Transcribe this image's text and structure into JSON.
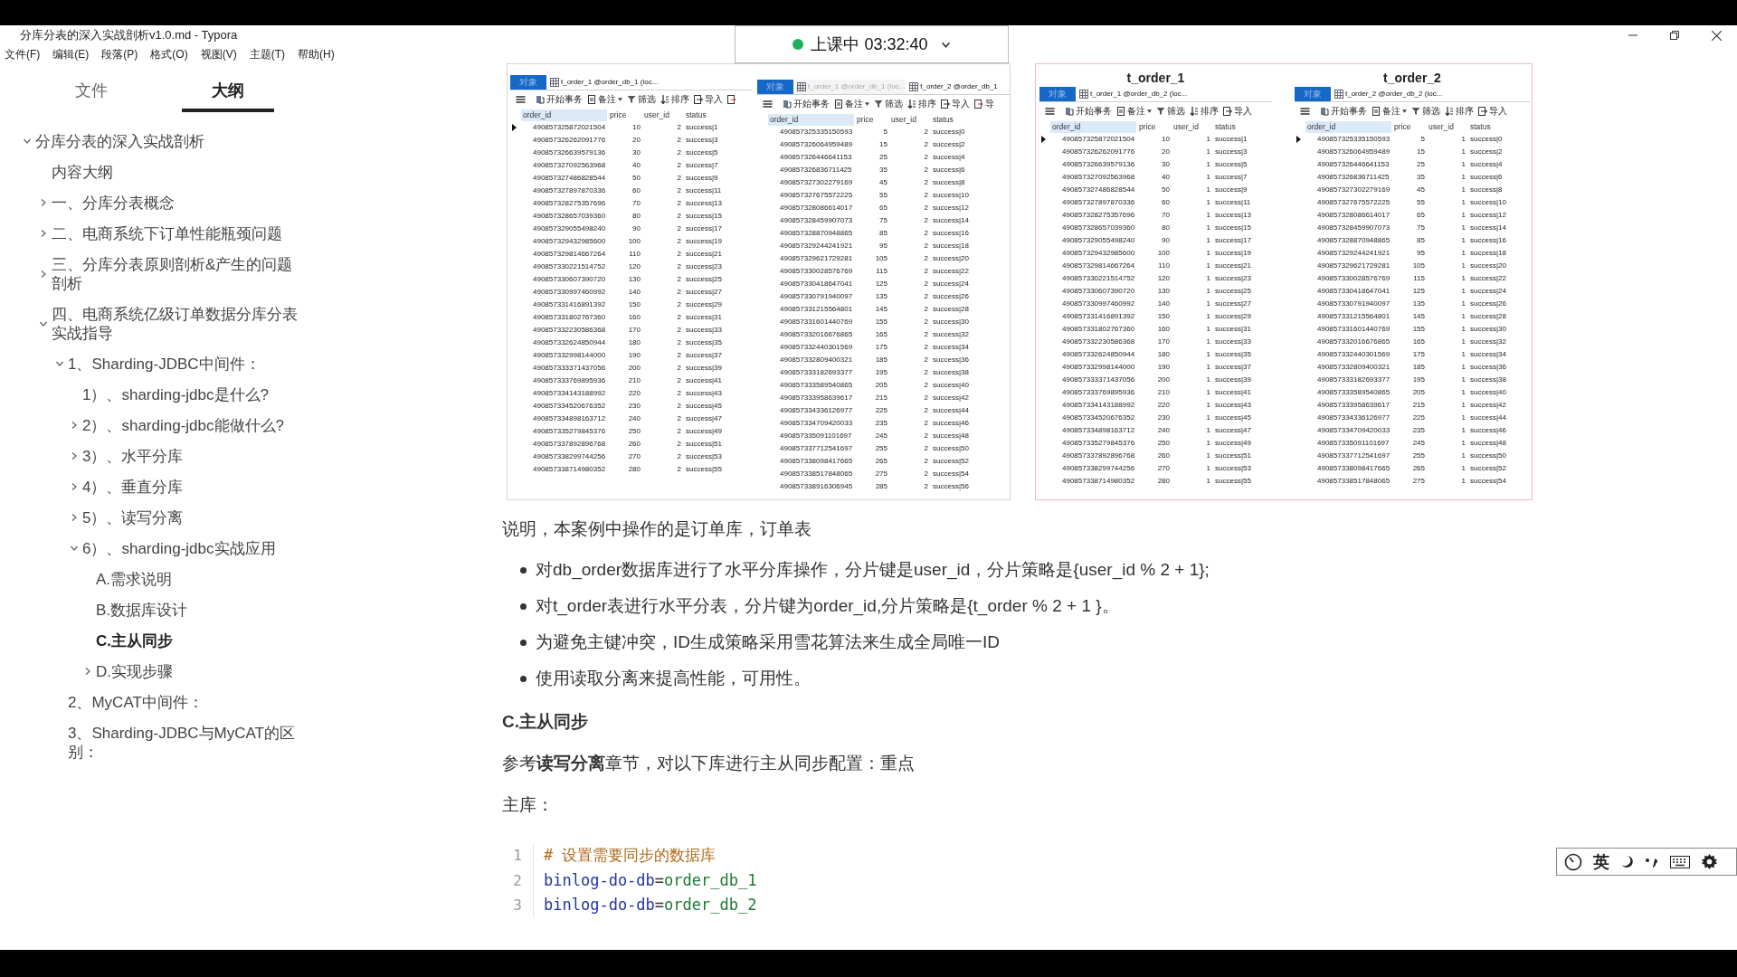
{
  "window": {
    "title": "分库分表的深入实战剖析v1.0.md - Typora"
  },
  "class_status": {
    "label": "上课中 03:32:40"
  },
  "menu": [
    "文件(F)",
    "编辑(E)",
    "段落(P)",
    "格式(O)",
    "视图(V)",
    "主题(T)",
    "帮助(H)"
  ],
  "sidebar": {
    "tabs": [
      {
        "label": "文件",
        "selected": false
      },
      {
        "label": "大纲",
        "selected": true
      }
    ],
    "outline": [
      {
        "label": "分库分表的深入实战剖析",
        "kind": "branch",
        "expanded": true,
        "selected": false,
        "children": [
          {
            "label": "内容大纲",
            "kind": "leaf",
            "selected": false
          },
          {
            "label": "一、分库分表概念",
            "kind": "branch",
            "expanded": false,
            "selected": false
          },
          {
            "label": "二、电商系统下订单性能瓶颈问题",
            "kind": "branch",
            "expanded": false,
            "selected": false
          },
          {
            "label": "三、分库分表原则剖析&产生的问题剖析",
            "kind": "branch",
            "expanded": false,
            "selected": false
          },
          {
            "label": "四、电商系统亿级订单数据分库分表实战指导",
            "kind": "branch",
            "expanded": true,
            "selected": false,
            "children": [
              {
                "label": "1、Sharding-JDBC中间件：",
                "kind": "branch",
                "expanded": true,
                "selected": false,
                "children": [
                  {
                    "label": "1）、sharding-jdbc是什么?",
                    "kind": "leaf",
                    "selected": false
                  },
                  {
                    "label": "2）、sharding-jdbc能做什么?",
                    "kind": "branch",
                    "expanded": false,
                    "selected": false
                  },
                  {
                    "label": "3）、水平分库",
                    "kind": "branch",
                    "expanded": false,
                    "selected": false
                  },
                  {
                    "label": "4）、垂直分库",
                    "kind": "branch",
                    "expanded": false,
                    "selected": false
                  },
                  {
                    "label": "5）、读写分离",
                    "kind": "branch",
                    "expanded": false,
                    "selected": false
                  },
                  {
                    "label": "6）、sharding-jdbc实战应用",
                    "kind": "branch",
                    "expanded": true,
                    "selected": false,
                    "children": [
                      {
                        "label": "A.需求说明",
                        "kind": "leaf",
                        "selected": false
                      },
                      {
                        "label": "B.数据库设计",
                        "kind": "leaf",
                        "selected": false
                      },
                      {
                        "label": "C.主从同步",
                        "kind": "leaf",
                        "selected": true
                      },
                      {
                        "label": "D.实现步骤",
                        "kind": "branch",
                        "expanded": false,
                        "selected": false
                      }
                    ]
                  }
                ]
              },
              {
                "label": "2、MyCAT中间件：",
                "kind": "leaf",
                "selected": false
              },
              {
                "label": "3、Sharding-JDBC与MyCAT的区别：",
                "kind": "leaf",
                "selected": false
              }
            ]
          }
        ]
      }
    ]
  },
  "document": {
    "images": [
      {
        "tables": [
          {
            "cursor_on_first_row": true,
            "tabs": [
              {
                "kind": "objects",
                "label": "对象"
              },
              {
                "kind": "table",
                "label": "t_order_1 @order_db_1 (loc...",
                "selected": true
              }
            ],
            "toolbar": [
              {
                "kind": "begin",
                "label": "开始事务"
              },
              {
                "kind": "note",
                "label": "备注"
              },
              {
                "kind": "filter",
                "label": "筛选"
              },
              {
                "kind": "sort",
                "label": "排序"
              },
              {
                "kind": "import",
                "label": "导入"
              },
              {
                "kind": "export"
              }
            ],
            "columns": [
              "order_id",
              "price",
              "user_id",
              "status"
            ],
            "rows": [
              [
                "490857325872021504",
                "10",
                "2",
                "success|1"
              ],
              [
                "490857326262091776",
                "20",
                "2",
                "success|3"
              ],
              [
                "490857326639579136",
                "30",
                "2",
                "success|5"
              ],
              [
                "490857327092563968",
                "40",
                "2",
                "success|7"
              ],
              [
                "490857327486828544",
                "50",
                "2",
                "success|9"
              ],
              [
                "490857327897870336",
                "60",
                "2",
                "success|11"
              ],
              [
                "490857328275357696",
                "70",
                "2",
                "success|13"
              ],
              [
                "490857328657039360",
                "80",
                "2",
                "success|15"
              ],
              [
                "490857329055498240",
                "90",
                "2",
                "success|17"
              ],
              [
                "490857329432985600",
                "100",
                "2",
                "success|19"
              ],
              [
                "490857329814667264",
                "110",
                "2",
                "success|21"
              ],
              [
                "490857330221514752",
                "120",
                "2",
                "success|23"
              ],
              [
                "490857330607390720",
                "130",
                "2",
                "success|25"
              ],
              [
                "490857330997460992",
                "140",
                "2",
                "success|27"
              ],
              [
                "490857331416891392",
                "150",
                "2",
                "success|29"
              ],
              [
                "490857331802767360",
                "160",
                "2",
                "success|31"
              ],
              [
                "490857332230586368",
                "170",
                "2",
                "success|33"
              ],
              [
                "490857332624850944",
                "180",
                "2",
                "success|35"
              ],
              [
                "490857332998144000",
                "190",
                "2",
                "success|37"
              ],
              [
                "490857333371437056",
                "200",
                "2",
                "success|39"
              ],
              [
                "490857333769895936",
                "210",
                "2",
                "success|41"
              ],
              [
                "490857334143188992",
                "220",
                "2",
                "success|43"
              ],
              [
                "490857334520676352",
                "230",
                "2",
                "success|45"
              ],
              [
                "490857334898163712",
                "240",
                "2",
                "success|47"
              ],
              [
                "490857335279845376",
                "250",
                "2",
                "success|49"
              ],
              [
                "490857337892896768",
                "260",
                "2",
                "success|51"
              ],
              [
                "490857338299744256",
                "270",
                "2",
                "success|53"
              ],
              [
                "490857338714980352",
                "280",
                "2",
                "success|55"
              ]
            ]
          },
          {
            "cursor_on_first_row": false,
            "tabs": [
              {
                "kind": "objects",
                "label": "对象"
              },
              {
                "kind": "table",
                "label": "t_order_1 @order_db_1 (loc...",
                "selected": false
              },
              {
                "kind": "table",
                "label": "t_order_2 @order_db_1",
                "selected": true
              }
            ],
            "toolbar": [
              {
                "kind": "begin",
                "label": "开始事务"
              },
              {
                "kind": "note",
                "label": "备注"
              },
              {
                "kind": "filter",
                "label": "筛选"
              },
              {
                "kind": "sort",
                "label": "排序"
              },
              {
                "kind": "import",
                "label": "导入"
              },
              {
                "kind": "export",
                "label": "导"
              }
            ],
            "columns": [
              "order_id",
              "price",
              "user_id",
              "status"
            ],
            "rows": [
              [
                "490857325335150593",
                "5",
                "2",
                "success|0"
              ],
              [
                "490857326064959489",
                "15",
                "2",
                "success|2"
              ],
              [
                "490857326446641153",
                "25",
                "2",
                "success|4"
              ],
              [
                "490857326836711425",
                "35",
                "2",
                "success|6"
              ],
              [
                "490857327302279169",
                "45",
                "2",
                "success|8"
              ],
              [
                "490857327675572225",
                "55",
                "2",
                "success|10"
              ],
              [
                "490857328086614017",
                "65",
                "2",
                "success|12"
              ],
              [
                "490857328459907073",
                "75",
                "2",
                "success|14"
              ],
              [
                "490857328870948865",
                "85",
                "2",
                "success|16"
              ],
              [
                "490857329244241921",
                "95",
                "2",
                "success|18"
              ],
              [
                "490857329621729281",
                "105",
                "2",
                "success|20"
              ],
              [
                "490857330028576769",
                "115",
                "2",
                "success|22"
              ],
              [
                "490857330418647041",
                "125",
                "2",
                "success|24"
              ],
              [
                "490857330791940097",
                "135",
                "2",
                "success|26"
              ],
              [
                "490857331215564801",
                "145",
                "2",
                "success|28"
              ],
              [
                "490857331601440769",
                "155",
                "2",
                "success|30"
              ],
              [
                "490857332016676865",
                "165",
                "2",
                "success|32"
              ],
              [
                "490857332440301569",
                "175",
                "2",
                "success|34"
              ],
              [
                "490857332809400321",
                "185",
                "2",
                "success|36"
              ],
              [
                "490857333182693377",
                "195",
                "2",
                "success|38"
              ],
              [
                "490857333589540865",
                "205",
                "2",
                "success|40"
              ],
              [
                "490857333958639617",
                "215",
                "2",
                "success|42"
              ],
              [
                "490857334336126977",
                "225",
                "2",
                "success|44"
              ],
              [
                "490857334709420033",
                "235",
                "2",
                "success|46"
              ],
              [
                "490857335091101697",
                "245",
                "2",
                "success|48"
              ],
              [
                "490857337712541697",
                "255",
                "2",
                "success|50"
              ],
              [
                "490857338098417665",
                "265",
                "2",
                "success|52"
              ],
              [
                "490857338517848065",
                "275",
                "2",
                "success|54"
              ],
              [
                "490857338916306945",
                "285",
                "2",
                "success|56"
              ]
            ]
          }
        ]
      },
      {
        "tables": [
          {
            "title": "t_order_1",
            "cursor_on_first_row": true,
            "tabs": [
              {
                "kind": "objects",
                "label": "对象"
              },
              {
                "kind": "table",
                "label": "t_order_1 @order_db_2 (loc...",
                "selected": true
              }
            ],
            "toolbar": [
              {
                "kind": "begin",
                "label": "开始事务"
              },
              {
                "kind": "note",
                "label": "备注"
              },
              {
                "kind": "filter",
                "label": "筛选"
              },
              {
                "kind": "sort",
                "label": "排序"
              },
              {
                "kind": "import",
                "label": "导入"
              }
            ],
            "columns": [
              "order_id",
              "price",
              "user_id",
              "status"
            ],
            "rows": [
              [
                "490857325872021504",
                "10",
                "1",
                "success|1"
              ],
              [
                "490857326262091776",
                "20",
                "1",
                "success|3"
              ],
              [
                "490857326639579136",
                "30",
                "1",
                "success|5"
              ],
              [
                "490857327092563968",
                "40",
                "1",
                "success|7"
              ],
              [
                "490857327486828544",
                "50",
                "1",
                "success|9"
              ],
              [
                "490857327897870336",
                "60",
                "1",
                "success|11"
              ],
              [
                "490857328275357696",
                "70",
                "1",
                "success|13"
              ],
              [
                "490857328657039360",
                "80",
                "1",
                "success|15"
              ],
              [
                "490857329055498240",
                "90",
                "1",
                "success|17"
              ],
              [
                "490857329432985600",
                "100",
                "1",
                "success|19"
              ],
              [
                "490857329814667264",
                "110",
                "1",
                "success|21"
              ],
              [
                "490857330221514752",
                "120",
                "1",
                "success|23"
              ],
              [
                "490857330607390720",
                "130",
                "1",
                "success|25"
              ],
              [
                "490857330997460992",
                "140",
                "1",
                "success|27"
              ],
              [
                "490857331416891392",
                "150",
                "1",
                "success|29"
              ],
              [
                "490857331802767360",
                "160",
                "1",
                "success|31"
              ],
              [
                "490857332230586368",
                "170",
                "1",
                "success|33"
              ],
              [
                "490857332624850944",
                "180",
                "1",
                "success|35"
              ],
              [
                "490857332998144000",
                "190",
                "1",
                "success|37"
              ],
              [
                "490857333371437056",
                "200",
                "1",
                "success|39"
              ],
              [
                "490857333769895936",
                "210",
                "1",
                "success|41"
              ],
              [
                "490857334143188992",
                "220",
                "1",
                "success|43"
              ],
              [
                "490857334520676352",
                "230",
                "1",
                "success|45"
              ],
              [
                "490857334898163712",
                "240",
                "1",
                "success|47"
              ],
              [
                "490857335279845376",
                "250",
                "1",
                "success|49"
              ],
              [
                "490857337892896768",
                "260",
                "1",
                "success|51"
              ],
              [
                "490857338299744256",
                "270",
                "1",
                "success|53"
              ],
              [
                "490857338714980352",
                "280",
                "1",
                "success|55"
              ]
            ]
          },
          {
            "title": "t_order_2",
            "cursor_on_first_row": true,
            "tabs": [
              {
                "kind": "objects",
                "label": "对象"
              },
              {
                "kind": "table",
                "label": "t_order_2 @order_db_2 (loc...",
                "selected": true
              }
            ],
            "toolbar": [
              {
                "kind": "begin",
                "label": "开始事务"
              },
              {
                "kind": "note",
                "label": "备注"
              },
              {
                "kind": "filter",
                "label": "筛选"
              },
              {
                "kind": "sort",
                "label": "排序"
              },
              {
                "kind": "import",
                "label": "导入"
              }
            ],
            "columns": [
              "order_id",
              "price",
              "user_id",
              "status"
            ],
            "rows": [
              [
                "490857325335150593",
                "5",
                "1",
                "success|0"
              ],
              [
                "490857326064959489",
                "15",
                "1",
                "success|2"
              ],
              [
                "490857326446641153",
                "25",
                "1",
                "success|4"
              ],
              [
                "490857326836711425",
                "35",
                "1",
                "success|6"
              ],
              [
                "490857327302279169",
                "45",
                "1",
                "success|8"
              ],
              [
                "490857327675572225",
                "55",
                "1",
                "success|10"
              ],
              [
                "490857328086614017",
                "65",
                "1",
                "success|12"
              ],
              [
                "490857328459907073",
                "75",
                "1",
                "success|14"
              ],
              [
                "490857328870948865",
                "85",
                "1",
                "success|16"
              ],
              [
                "490857329244241921",
                "95",
                "1",
                "success|18"
              ],
              [
                "490857329621729281",
                "105",
                "1",
                "success|20"
              ],
              [
                "490857330028576769",
                "115",
                "1",
                "success|22"
              ],
              [
                "490857330418647041",
                "125",
                "1",
                "success|24"
              ],
              [
                "490857330791940097",
                "135",
                "1",
                "success|26"
              ],
              [
                "490857331215564801",
                "145",
                "1",
                "success|28"
              ],
              [
                "490857331601440769",
                "155",
                "1",
                "success|30"
              ],
              [
                "490857332016676865",
                "165",
                "1",
                "success|32"
              ],
              [
                "490857332440301569",
                "175",
                "1",
                "success|34"
              ],
              [
                "490857332809400321",
                "185",
                "1",
                "success|36"
              ],
              [
                "490857333182693377",
                "195",
                "1",
                "success|38"
              ],
              [
                "490857333589540865",
                "205",
                "1",
                "success|40"
              ],
              [
                "490857333958639617",
                "215",
                "1",
                "success|42"
              ],
              [
                "490857334336126977",
                "225",
                "1",
                "success|44"
              ],
              [
                "490857334709420033",
                "235",
                "1",
                "success|46"
              ],
              [
                "490857335091101697",
                "245",
                "1",
                "success|48"
              ],
              [
                "490857337712541697",
                "255",
                "1",
                "success|50"
              ],
              [
                "490857338098417665",
                "265",
                "1",
                "success|52"
              ],
              [
                "490857338517848065",
                "275",
                "1",
                "success|54"
              ]
            ]
          }
        ]
      }
    ],
    "blocks": [
      {
        "kind": "paragraph",
        "text": "说明，本案例中操作的是订单库，订单表"
      },
      {
        "kind": "bullets",
        "items": [
          "对db_order数据库进行了水平分库操作，分片键是user_id，分片策略是{user_id % 2 + 1};",
          "对t_order表进行水平分表，分片键为order_id,分片策略是{t_order % 2 + 1 }。",
          "为避免主键冲突，ID生成策略采用雪花算法来生成全局唯一ID",
          "使用读取分离来提高性能，可用性。"
        ]
      },
      {
        "kind": "heading",
        "text": "C.主从同步"
      },
      {
        "kind": "paragraph",
        "text": "参考**读写分离**章节，对以下库进行主从同步配置：重点"
      },
      {
        "kind": "paragraph",
        "text": "主库："
      },
      {
        "kind": "code",
        "lines": [
          {
            "number": "1",
            "tokens": [
              {
                "kind": "comment",
                "text": "# 设置需要同步的数据库"
              }
            ]
          },
          {
            "number": "2",
            "tokens": [
              {
                "kind": "key",
                "text": "binlog-do-db"
              },
              {
                "kind": "operator",
                "text": "="
              },
              {
                "kind": "value",
                "text": "order_db_1"
              }
            ]
          },
          {
            "number": "3",
            "tokens": [
              {
                "kind": "key",
                "text": "binlog-do-db"
              },
              {
                "kind": "operator",
                "text": "="
              },
              {
                "kind": "value",
                "text": "order_db_2"
              }
            ]
          }
        ]
      }
    ]
  },
  "ime_toolbar": {
    "mode": "英"
  }
}
